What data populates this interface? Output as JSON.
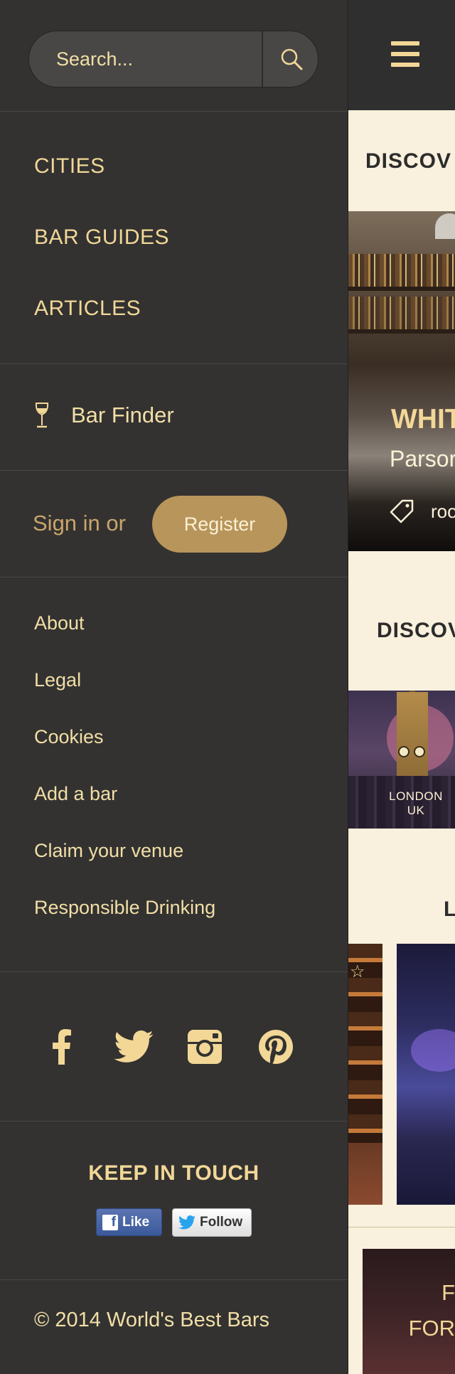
{
  "search": {
    "placeholder": "Search..."
  },
  "nav_main": [
    "CITIES",
    "BAR GUIDES",
    "ARTICLES"
  ],
  "bar_finder": {
    "label": "Bar Finder",
    "icon": "wine-glass-icon"
  },
  "account": {
    "signin_text": "Sign in or",
    "register_label": "Register"
  },
  "footer_links": [
    "About",
    "Legal",
    "Cookies",
    "Add a bar",
    "Claim your venue",
    "Responsible Drinking"
  ],
  "social": [
    "facebook-icon",
    "twitter-icon",
    "instagram-icon",
    "pinterest-icon"
  ],
  "keep_in_touch": {
    "title": "KEEP IN TOUCH",
    "like_label": "Like",
    "follow_label": "Follow"
  },
  "copyright": "© 2014 World's Best Bars",
  "colors": {
    "accent": "#f2d797",
    "register_bg": "#b8955a",
    "sidebar_bg": "#333231",
    "main_bg": "#f9f0dd"
  },
  "main": {
    "section1_title": "DISCOV",
    "featured_bar": {
      "title": "WHIT",
      "subtitle": "Parsor",
      "tag": "roo"
    },
    "section2_title": "DISCOV",
    "city": {
      "name": "LONDON",
      "country": "UK"
    },
    "section3_title": "L",
    "promo_line1": "F",
    "promo_line2": "FOR"
  }
}
